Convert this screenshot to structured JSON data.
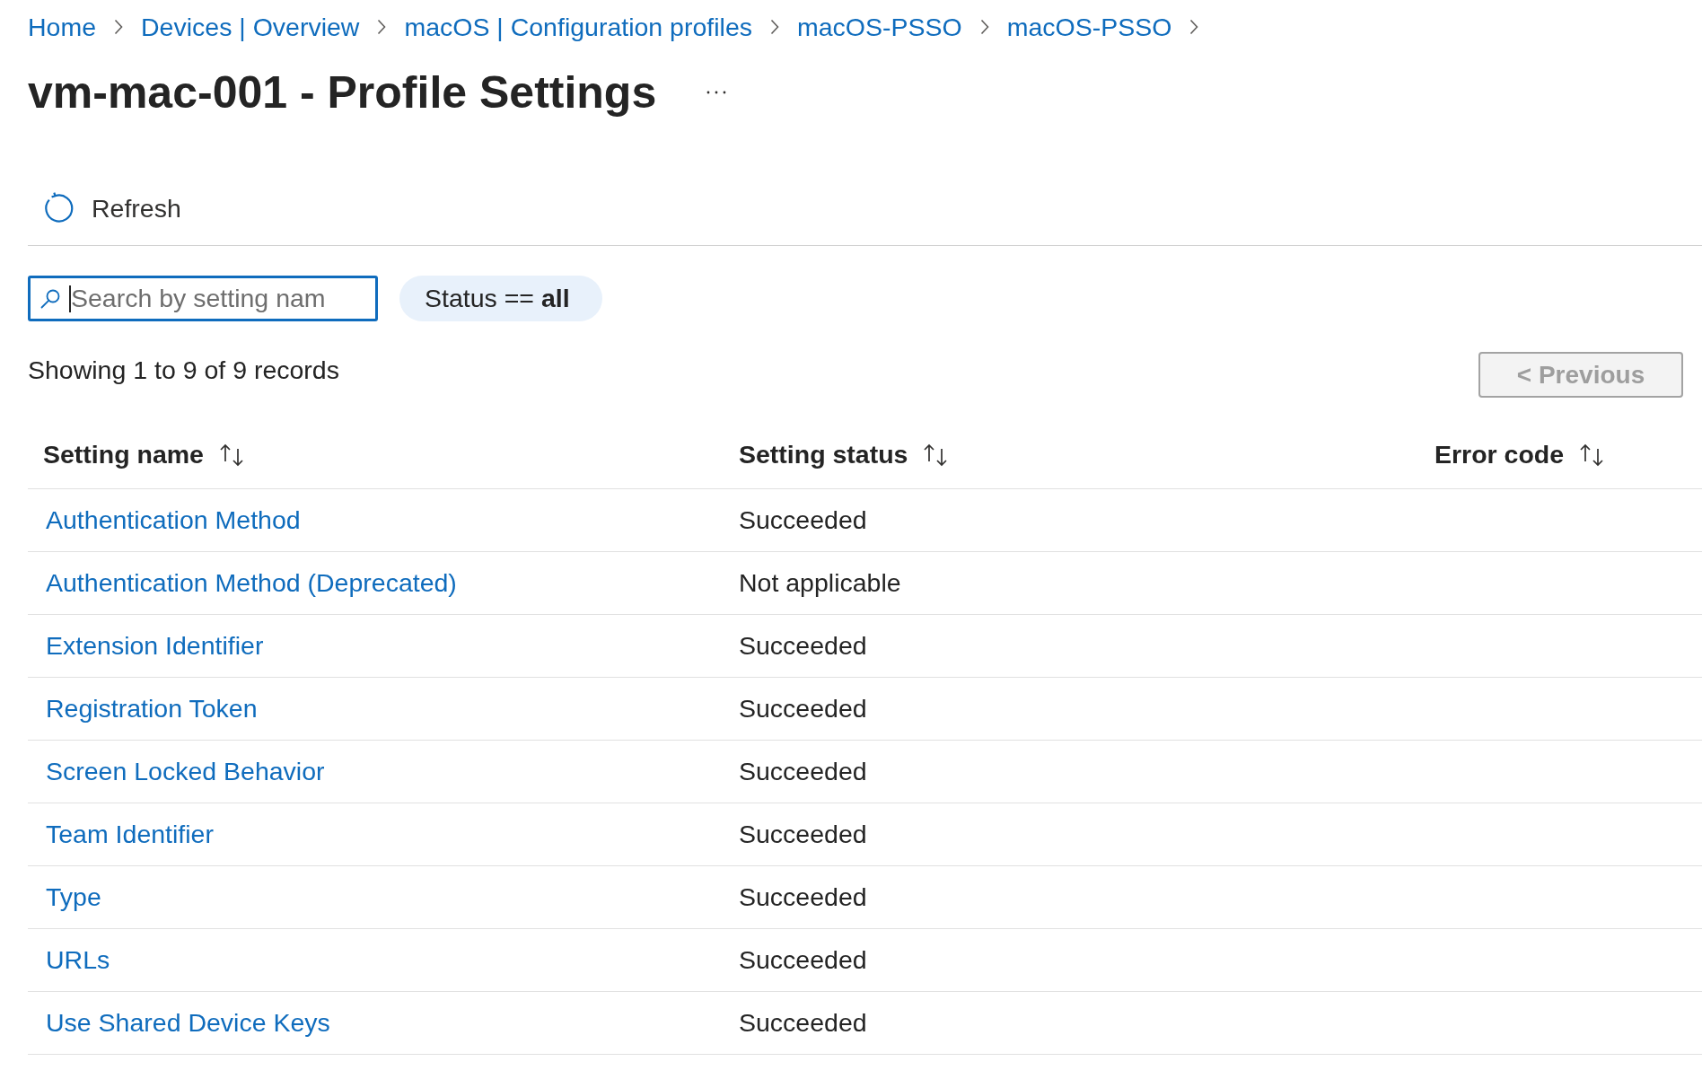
{
  "breadcrumb": [
    "Home",
    "Devices | Overview",
    "macOS | Configuration profiles",
    "macOS-PSSO",
    "macOS-PSSO"
  ],
  "page": {
    "title": "vm-mac-001 - Profile Settings"
  },
  "toolbar": [
    {
      "label": "Refresh",
      "kind": "refresh"
    }
  ],
  "search": {
    "placeholder": "Search by setting nam",
    "focused": true
  },
  "filter": {
    "label": "Status == **all**"
  },
  "records_summary": "Showing 1 to 9 of 9 records",
  "pagination": {
    "previous": {
      "label": "< Previous",
      "disabled": true
    }
  },
  "table": {
    "columns": [
      {
        "label": "Setting name",
        "sortable": true
      },
      {
        "label": "Setting status",
        "sortable": true
      },
      {
        "label": "Error code",
        "sortable": true
      }
    ],
    "rows": [
      {
        "setting_name": "Authentication Method",
        "setting_status": "Succeeded"
      },
      {
        "setting_name": "Authentication Method (Deprecated)",
        "setting_status": "Not applicable"
      },
      {
        "setting_name": "Extension Identifier",
        "setting_status": "Succeeded"
      },
      {
        "setting_name": "Registration Token",
        "setting_status": "Succeeded"
      },
      {
        "setting_name": "Screen Locked Behavior",
        "setting_status": "Succeeded"
      },
      {
        "setting_name": "Team Identifier",
        "setting_status": "Succeeded"
      },
      {
        "setting_name": "Type",
        "setting_status": "Succeeded"
      },
      {
        "setting_name": "URLs",
        "setting_status": "Succeeded"
      },
      {
        "setting_name": "Use Shared Device Keys",
        "setting_status": "Succeeded"
      }
    ]
  }
}
